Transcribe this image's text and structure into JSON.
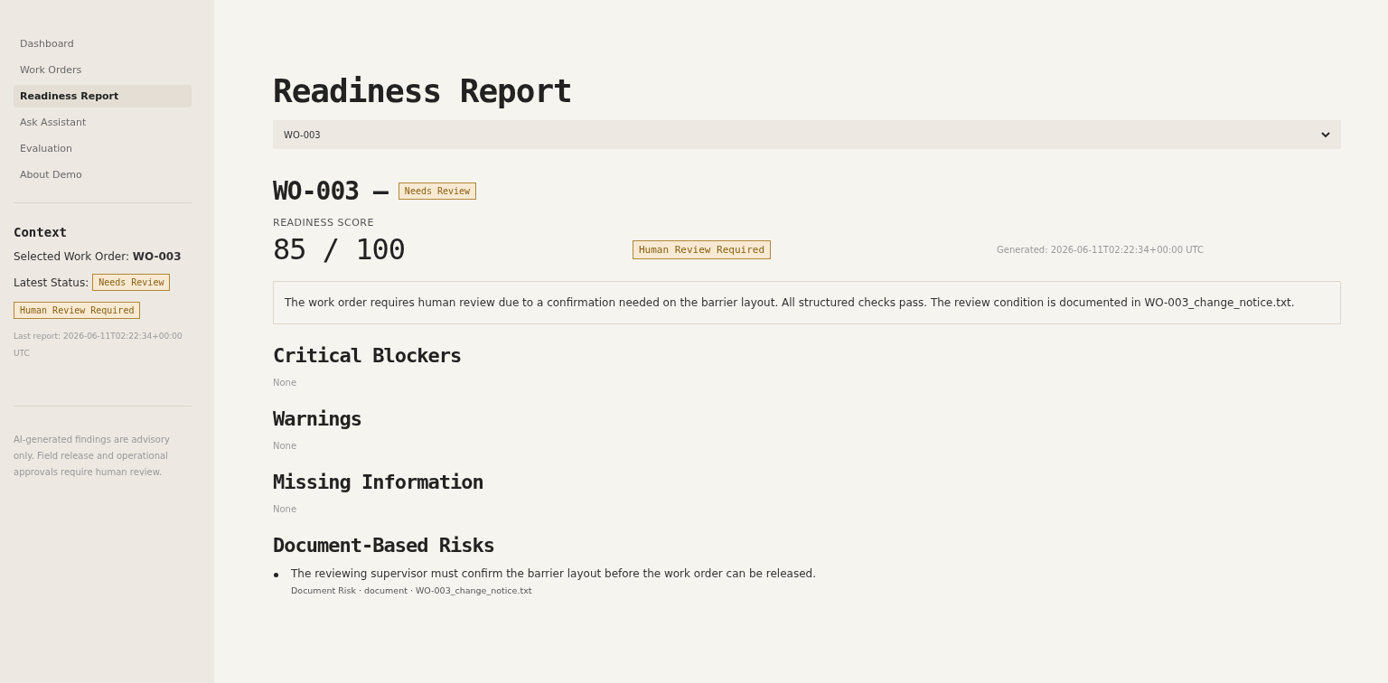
{
  "sidebar": {
    "items": [
      {
        "label": "Dashboard",
        "selected": false
      },
      {
        "label": "Work Orders",
        "selected": false
      },
      {
        "label": "Readiness Report",
        "selected": true
      },
      {
        "label": "Ask Assistant",
        "selected": false
      },
      {
        "label": "Evaluation",
        "selected": false
      },
      {
        "label": "About Demo",
        "selected": false
      }
    ],
    "context": {
      "title": "Context",
      "selected_work_order": "Selected Work Order: **WO-003**",
      "status_label": "Latest Status:",
      "status_badge": "Needs Review",
      "review_badge": "Human Review Required",
      "last_report": "Last report: 2026-06-11T02:22:34+00:00 UTC"
    },
    "disclaimer": "AI-generated findings are advisory only. Field release and operational approvals require human review."
  },
  "main": {
    "title": "Readiness Report",
    "work_order_select": {
      "value": "WO-003"
    },
    "report": {
      "heading": "WO-003 –",
      "status_badge": "Needs Review",
      "score_label": "READINESS SCORE",
      "score": "85 / 100",
      "review_badge": "Human Review Required",
      "generated": "Generated: 2026-06-11T02:22:34+00:00 UTC",
      "summary": "The work order requires human review due to a confirmation needed on the barrier layout. All structured checks pass. The review condition is documented in WO-003_change_notice.txt."
    },
    "sections": [
      {
        "title": "Critical Blockers",
        "empty_text": "None"
      },
      {
        "title": "Warnings",
        "empty_text": "None"
      },
      {
        "title": "Missing Information",
        "empty_text": "None"
      },
      {
        "title": "Document-Based Risks",
        "items": [
          {
            "text": "The reviewing supervisor must confirm the barrier layout before the work order can be released.",
            "meta": "Document Risk · document · WO-003_change_notice.txt"
          }
        ]
      }
    ]
  }
}
